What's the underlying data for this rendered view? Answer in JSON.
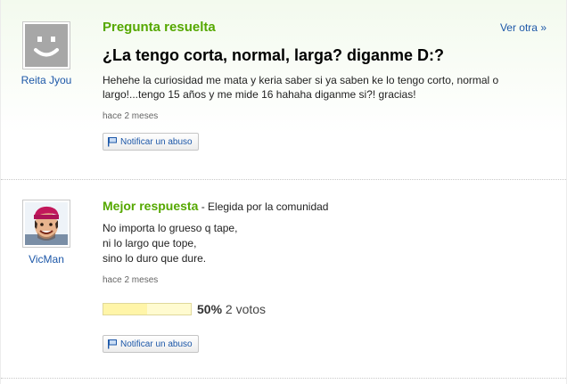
{
  "question": {
    "status_title": "Pregunta resuelta",
    "nav_link": "Ver otra",
    "nav_chevron": "»",
    "title": "¿La tengo corta, normal, larga? diganme D:?",
    "body": "Hehehe la curiosidad me mata y keria saber si ya saben ke lo tengo corto, normal o largo!...tengo 15 años y me mide 16 hahaha diganme si?! gracias!",
    "time": "hace 2 meses",
    "report_label": "Notificar un abuso",
    "user": {
      "name": "Reita Jyou",
      "avatar": "smiley-avatar-icon"
    }
  },
  "answer": {
    "title": "Mejor respuesta",
    "subtitle": " - Elegida por la comunidad",
    "lines": [
      "No importa lo grueso q tape,",
      "ni lo largo que tope,",
      "sino lo duro que dure."
    ],
    "time": "hace 2 meses",
    "vote_percent": "50%",
    "vote_fraction": 0.5,
    "vote_count": "2 votos",
    "report_label": "Notificar un abuso",
    "user": {
      "name": "VicMan",
      "avatar": "user-photo-avatar"
    }
  },
  "colors": {
    "green": "#55a800",
    "link_blue": "#1c57a8",
    "vote_bar": "#fffbd0"
  }
}
